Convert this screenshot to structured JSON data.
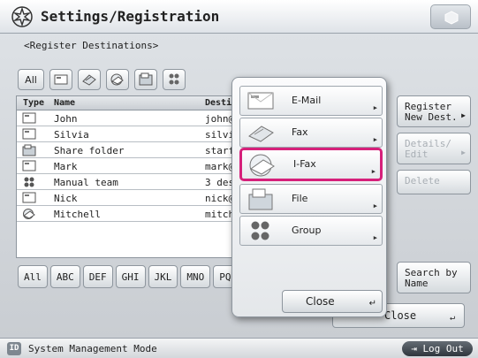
{
  "header": {
    "title": "Settings/Registration"
  },
  "subtitle": "<Register Destinations>",
  "filter": {
    "all_label": "All",
    "icons": [
      "email-icon",
      "fax-icon",
      "ifax-icon",
      "file-icon",
      "group-icon"
    ]
  },
  "list": {
    "columns": {
      "type": "Type",
      "name": "Name",
      "dest": "Destin"
    },
    "rows": [
      {
        "icon": "email-icon",
        "name": "John",
        "dest": "john@"
      },
      {
        "icon": "email-icon",
        "name": "Silvia",
        "dest": "silvi"
      },
      {
        "icon": "file-icon",
        "name": "Share folder",
        "dest": "starf"
      },
      {
        "icon": "email-icon",
        "name": "Mark",
        "dest": "mark@"
      },
      {
        "icon": "group-icon",
        "name": "Manual team",
        "dest": "3 des"
      },
      {
        "icon": "email-icon",
        "name": "Nick",
        "dest": "nick@"
      },
      {
        "icon": "ifax-icon",
        "name": "Mitchell",
        "dest": "mitch"
      }
    ]
  },
  "alpha": [
    "All",
    "ABC",
    "DEF",
    "GHI",
    "JKL",
    "MNO",
    "PQR"
  ],
  "side": {
    "register": "Register New Dest.",
    "details": "Details/ Edit",
    "delete": "Delete",
    "search": "Search by Name",
    "close": "Close"
  },
  "popup": {
    "items": [
      {
        "label": "E-Mail",
        "icon": "email-icon"
      },
      {
        "label": "Fax",
        "icon": "fax-icon"
      },
      {
        "label": "I-Fax",
        "icon": "ifax-icon"
      },
      {
        "label": "File",
        "icon": "file-icon"
      },
      {
        "label": "Group",
        "icon": "group-icon"
      }
    ],
    "selected": "I-Fax",
    "close": "Close"
  },
  "footer": {
    "id_badge": "ID",
    "mode": "System Management Mode",
    "logout": "Log Out"
  },
  "colors": {
    "selection": "#d6207a",
    "logout_bg": "#3a4148"
  }
}
